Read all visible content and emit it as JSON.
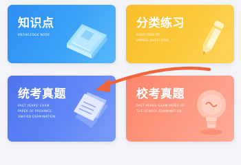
{
  "cards": [
    {
      "title": "知识点",
      "subtitle_lines": [
        "KNOWLEDGE NODE"
      ],
      "icon": "book-icon",
      "color": "#3aa2f7"
    },
    {
      "title": "分类练习",
      "subtitle_lines": [
        "EXERCISES OF",
        "VARIED QUESTIONS"
      ],
      "icon": "pencil-icon",
      "color": "#fcc93c"
    },
    {
      "title": "统考真题",
      "subtitle_lines": [
        "PAST YEARS' EXAM",
        "PAPER OF PROVINCE",
        "UNIFIED EXAMINATION"
      ],
      "icon": "papers-icon",
      "color": "#5f86f6"
    },
    {
      "title": "校考真题",
      "subtitle_lines": [
        "PAST YEARS' EXAM PAPER OF",
        "THE SCHOOL EXAMINATION"
      ],
      "icon": "lightbulb-icon",
      "color": "#fd9a83"
    }
  ],
  "annotation": {
    "icon": "arrow-icon",
    "color": "#f2643a"
  }
}
